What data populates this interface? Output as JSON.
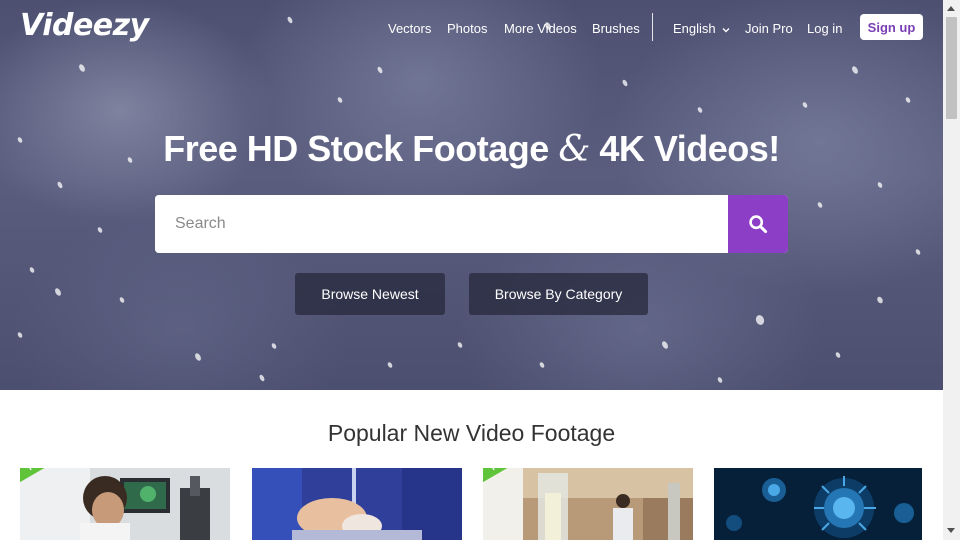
{
  "brand": {
    "logo": "Videezy"
  },
  "nav": {
    "links": [
      "Vectors",
      "Photos",
      "More Videos",
      "Brushes"
    ],
    "language": "English",
    "join_pro": "Join Pro",
    "login": "Log in",
    "signup": "Sign up"
  },
  "hero": {
    "title_part1": "Free HD Stock Footage",
    "title_amp": "&",
    "title_part2": "4K Videos!",
    "search_placeholder": "Search",
    "browse_newest": "Browse Newest",
    "browse_category": "Browse By Category"
  },
  "section": {
    "title": "Popular New Video Footage"
  },
  "thumbnails": [
    {
      "badge": "PRO"
    },
    {
      "badge": ""
    },
    {
      "badge": "PRO"
    },
    {
      "badge": ""
    }
  ],
  "colors": {
    "accent": "#8c3fc6",
    "pro_badge": "#5fc43a",
    "signup_text": "#7a3fb5"
  }
}
